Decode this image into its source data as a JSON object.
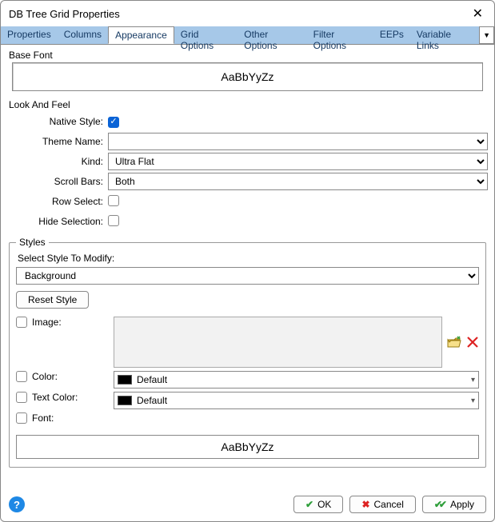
{
  "window": {
    "title": "DB Tree Grid Properties"
  },
  "tabs": {
    "items": [
      "Properties",
      "Columns",
      "Appearance",
      "Grid Options",
      "Other Options",
      "Filter Options",
      "EEPs",
      "Variable Links"
    ],
    "active": "Appearance"
  },
  "baseFont": {
    "label": "Base Font",
    "sample": "AaBbYyZz"
  },
  "lookAndFeel": {
    "label": "Look And Feel",
    "nativeStyle": {
      "label": "Native Style:",
      "checked": true
    },
    "themeName": {
      "label": "Theme Name:",
      "value": ""
    },
    "kind": {
      "label": "Kind:",
      "value": "Ultra Flat"
    },
    "scrollBars": {
      "label": "Scroll Bars:",
      "value": "Both"
    },
    "rowSelect": {
      "label": "Row Select:",
      "checked": false
    },
    "hideSelection": {
      "label": "Hide Selection:",
      "checked": false
    }
  },
  "styles": {
    "legend": "Styles",
    "selectLabel": "Select Style To Modify:",
    "selectValue": "Background",
    "resetLabel": "Reset Style",
    "image": {
      "label": "Image:",
      "checked": false
    },
    "color": {
      "label": "Color:",
      "checked": false,
      "value": "Default"
    },
    "textColor": {
      "label": "Text Color:",
      "checked": false,
      "value": "Default"
    },
    "font": {
      "label": "Font:",
      "checked": false
    },
    "sample": "AaBbYyZz"
  },
  "footer": {
    "ok": "OK",
    "cancel": "Cancel",
    "apply": "Apply"
  }
}
